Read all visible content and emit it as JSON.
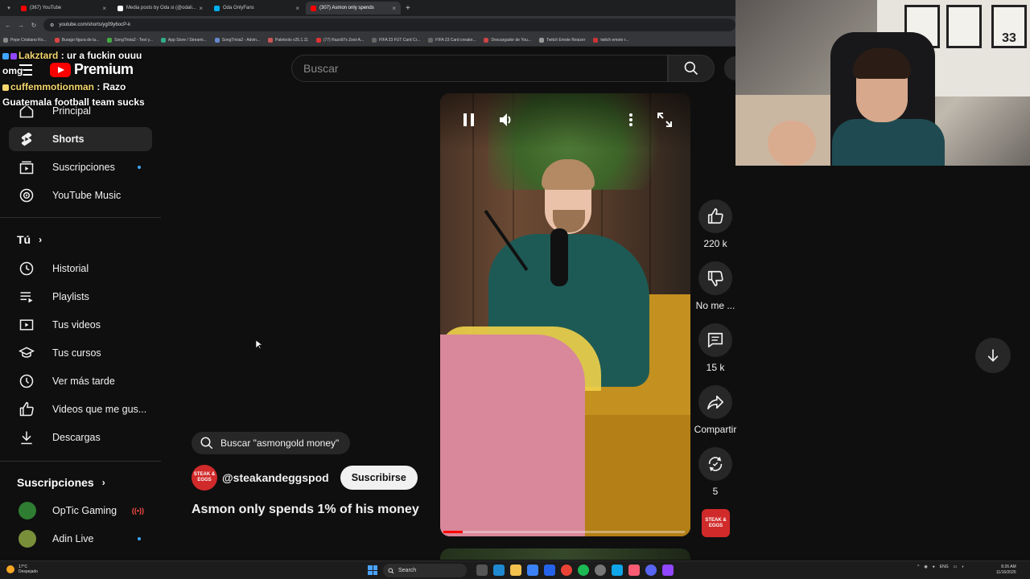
{
  "browser": {
    "tabs": [
      {
        "label": "(367) YouTube",
        "color": "#ff0000",
        "active": false
      },
      {
        "label": "Media posts by Oda si (@odali...",
        "color": "#ffffff",
        "active": false
      },
      {
        "label": "Oda OnlyFans",
        "color": "#00aff0",
        "active": false
      },
      {
        "label": "(307) Asmon only spends",
        "color": "#ff0000",
        "active": true
      }
    ],
    "url": "youtube.com/shorts/yg09y6ocP-k",
    "bookmarks": [
      "Pepe Cristiano Ro...",
      "Burago figura de la...",
      "SongTrivia2 - Test y...",
      "App Store / Streami...",
      "SongTrivia2 - Advin...",
      "Paletools v25.1.11",
      "(77) Razo97s Zest-A...",
      "FIFA 23 FUT Card Cr...",
      "FIFA 23 Card creator...",
      "Descargador de You...",
      "Twitch Emote Resizer",
      "twitch emote r..."
    ]
  },
  "chat": [
    {
      "user": "Lakztard",
      "message": ": ur a fuckin ouuu omg"
    },
    {
      "user": "cuffemmotionman",
      "message": ": Razo Guatemala football team sucks"
    }
  ],
  "header": {
    "logo_text": "Premium",
    "search_placeholder": "Buscar"
  },
  "sidebar": {
    "top_items": [
      {
        "label": "Principal",
        "icon": "home-icon",
        "active": false
      },
      {
        "label": "Shorts",
        "icon": "shorts-icon",
        "active": true
      },
      {
        "label": "Suscripciones",
        "icon": "subscriptions-icon",
        "active": false,
        "dot": true
      },
      {
        "label": "YouTube Music",
        "icon": "music-icon",
        "active": false
      }
    ],
    "you_title": "Tú",
    "you_items": [
      {
        "label": "Historial",
        "icon": "history-icon"
      },
      {
        "label": "Playlists",
        "icon": "playlists-icon"
      },
      {
        "label": "Tus videos",
        "icon": "your-videos-icon"
      },
      {
        "label": "Tus cursos",
        "icon": "courses-icon"
      },
      {
        "label": "Ver más tarde",
        "icon": "watch-later-icon"
      },
      {
        "label": "Videos que me gus...",
        "icon": "liked-videos-icon"
      },
      {
        "label": "Descargas",
        "icon": "downloads-icon"
      }
    ],
    "subs_title": "Suscripciones",
    "subs_items": [
      {
        "label": "OpTic Gaming",
        "color": "#2f7d32",
        "status": "live"
      },
      {
        "label": "Adin Live",
        "color": "#7a8f3a",
        "status": "dot"
      }
    ]
  },
  "short": {
    "ask_label": "Buscar \"asmongold money\"",
    "channel_handle": "@steakandeggspod",
    "subscribe_label": "Suscribirse",
    "title": "Asmon only spends 1% of his money",
    "progress": 0.08,
    "avatar_text": "STEAK & EGGS"
  },
  "actions": {
    "like_count": "220 k",
    "dislike_label": "No me ...",
    "comments_count": "15 k",
    "share_label": "Compartir",
    "remix_count": "5"
  },
  "webcam": {
    "jersey_text": "33"
  },
  "taskbar": {
    "weather_temp": "17°C",
    "weather_desc": "Despejado",
    "search_label": "Search",
    "lang": "ENG",
    "time": "8:26 AM",
    "date": "11/16/2025"
  }
}
